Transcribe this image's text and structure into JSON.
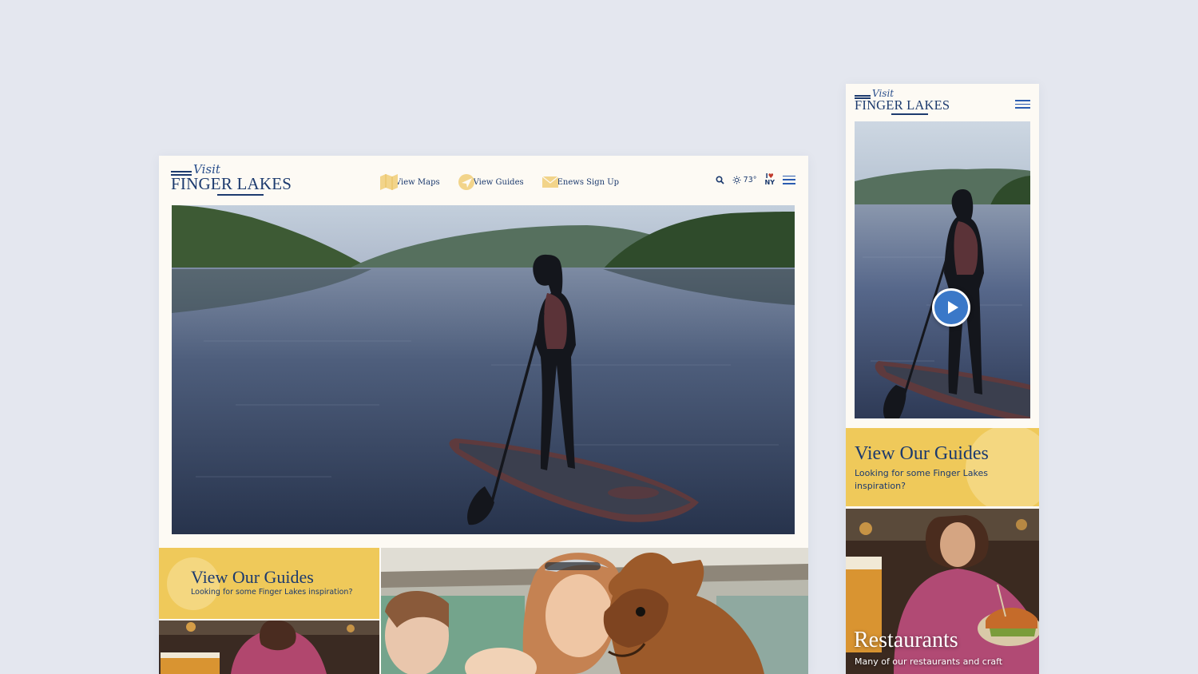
{
  "desktop": {
    "logo": {
      "visit": "Visit",
      "name": "FINGER LAKES"
    },
    "nav": [
      {
        "label": "View Maps",
        "icon": "map-icon"
      },
      {
        "label": "View Guides",
        "icon": "paper-plane-icon"
      },
      {
        "label": "Enews Sign Up",
        "icon": "envelope-icon"
      }
    ],
    "weather": {
      "icon": "sun-icon",
      "temp": "73°"
    },
    "iny": {
      "i": "I",
      "heart": "♥",
      "ny": "NY"
    },
    "guides": {
      "title": "View Our Guides",
      "subtitle": "Looking for some Finger Lakes inspiration?"
    }
  },
  "mobile": {
    "logo": {
      "visit": "Visit",
      "name": "FINGER LAKES"
    },
    "guides": {
      "title": "View Our Guides",
      "subtitle": "Looking for some Finger Lakes inspiration?"
    },
    "restaurants": {
      "title": "Restaurants",
      "subtitle": "Many of our restaurants and craft"
    }
  },
  "colors": {
    "background": "#e4e7ef",
    "page": "#fdfaf4",
    "navy": "#1c3a6e",
    "gold": "#efc95a",
    "accent_blue": "#3a78c8"
  }
}
